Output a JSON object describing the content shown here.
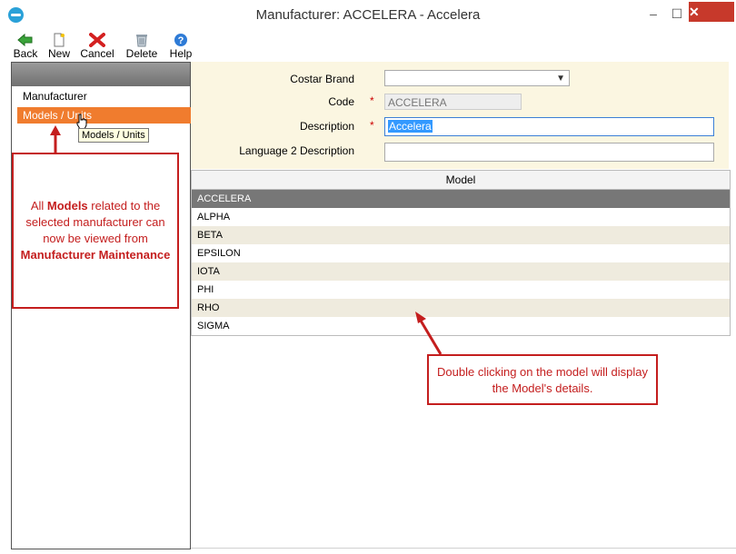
{
  "window": {
    "title": "Manufacturer: ACCELERA - Accelera",
    "minimize": "–",
    "maximize": "☐",
    "close": "✕"
  },
  "toolbar": {
    "back": "Back",
    "new": "New",
    "cancel": "Cancel",
    "delete": "Delete",
    "help": "Help"
  },
  "sidebar": {
    "items": [
      {
        "label": "Manufacturer"
      },
      {
        "label": "Models / Units"
      }
    ],
    "tooltip": "Models / Units"
  },
  "form": {
    "costar_brand_label": "Costar Brand",
    "costar_brand_value": "",
    "code_label": "Code",
    "code_value": "ACCELERA",
    "description_label": "Description",
    "description_value": "Accelera",
    "lang2_label": "Language 2 Description",
    "lang2_value": "",
    "required_mark": "*"
  },
  "grid": {
    "header": "Model",
    "rows": [
      "ACCELERA",
      "ALPHA",
      "BETA",
      "EPSILON",
      "IOTA",
      "PHI",
      "RHO",
      "SIGMA"
    ]
  },
  "annotations": {
    "left_pre": "All ",
    "left_bold1": "Models",
    "left_mid": " related to the selected manufacturer can now be viewed from ",
    "left_bold2": "Manufacturer Maintenance",
    "right": "Double clicking on the model will display the Model's details."
  },
  "colors": {
    "accent_orange": "#f07c2e",
    "annotation_red": "#c41e1e",
    "selected_row": "#777777",
    "form_bg": "#fbf6e1"
  }
}
